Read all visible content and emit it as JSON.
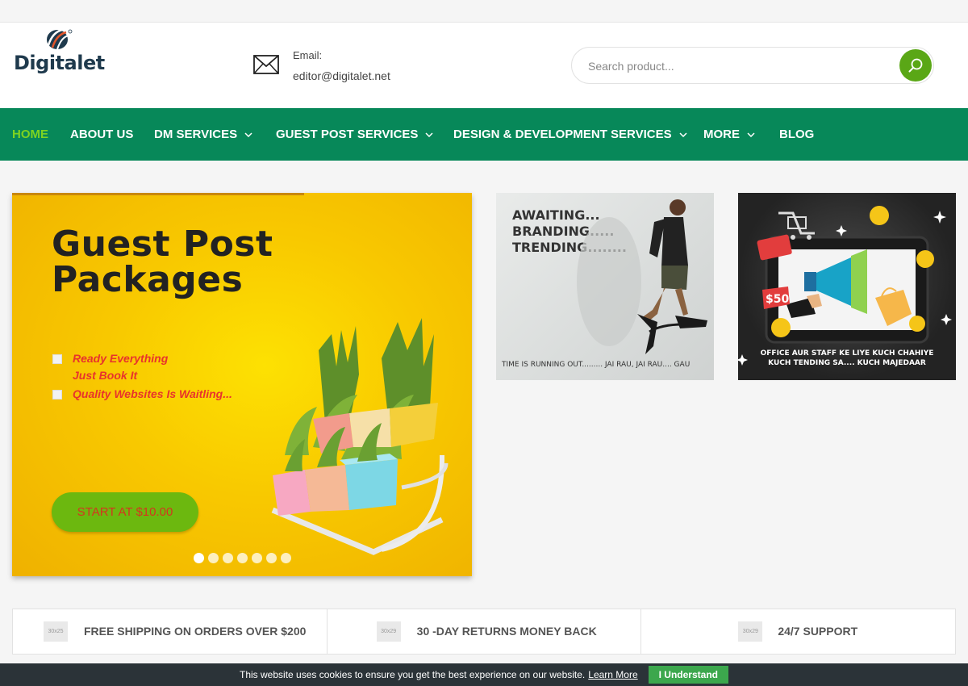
{
  "site": {
    "logo_text": "Digitalet"
  },
  "contact": {
    "label": "Email:",
    "value": "editor@digitalet.net"
  },
  "search": {
    "placeholder": "Search product..."
  },
  "nav": {
    "items": [
      {
        "label": "HOME",
        "active": true,
        "dropdown": false
      },
      {
        "label": "ABOUT US",
        "active": false,
        "dropdown": false
      },
      {
        "label": "DM SERVICES",
        "active": false,
        "dropdown": true
      },
      {
        "label": "GUEST POST SERVICES",
        "active": false,
        "dropdown": true
      },
      {
        "label": "DESIGN & DEVELOPMENT SERVICES",
        "active": false,
        "dropdown": true
      },
      {
        "label": "MORE",
        "active": false,
        "dropdown": true
      },
      {
        "label": "BLOG",
        "active": false,
        "dropdown": false
      }
    ]
  },
  "hero": {
    "title_line1": "Guest Post",
    "title_line2": "Packages",
    "feature1_line1": "Ready Everything",
    "feature1_line2": "Just Book It",
    "feature2": "Quality Websites Is Waitling...",
    "button_label": "START AT $10.00",
    "slide_count": 7,
    "active_slide": 0
  },
  "banner1": {
    "line1": "AWAITING...",
    "line2": "BRANDING.....",
    "line3": "TRENDING........",
    "footer": "TIME IS RUNNING OUT......... JAI RAU, JAI RAU.... GAU"
  },
  "banner2": {
    "price_tag": "$50",
    "footer_line1": "OFFICE AUR STAFF KE LIYE KUCH CHAHIYE",
    "footer_line2": "KUCH TENDING SA.... KUCH MAJEDAAR"
  },
  "features": [
    {
      "placeholder": "30x25",
      "label": "FREE SHIPPING ON ORDERS OVER $200"
    },
    {
      "placeholder": "30x29",
      "label": "30 -DAY RETURNS MONEY BACK"
    },
    {
      "placeholder": "30x29",
      "label": "24/7 SUPPORT"
    }
  ],
  "cookie": {
    "text": "This website uses cookies to ensure you get the best experience on our website.",
    "link_label": "Learn More",
    "button_label": "I Understand"
  },
  "colors": {
    "nav_bg": "#078859",
    "nav_active": "#7ed321",
    "accent_green": "#5aa716",
    "hero_yellow": "#f8c800",
    "cookie_bg": "#2b3338"
  }
}
